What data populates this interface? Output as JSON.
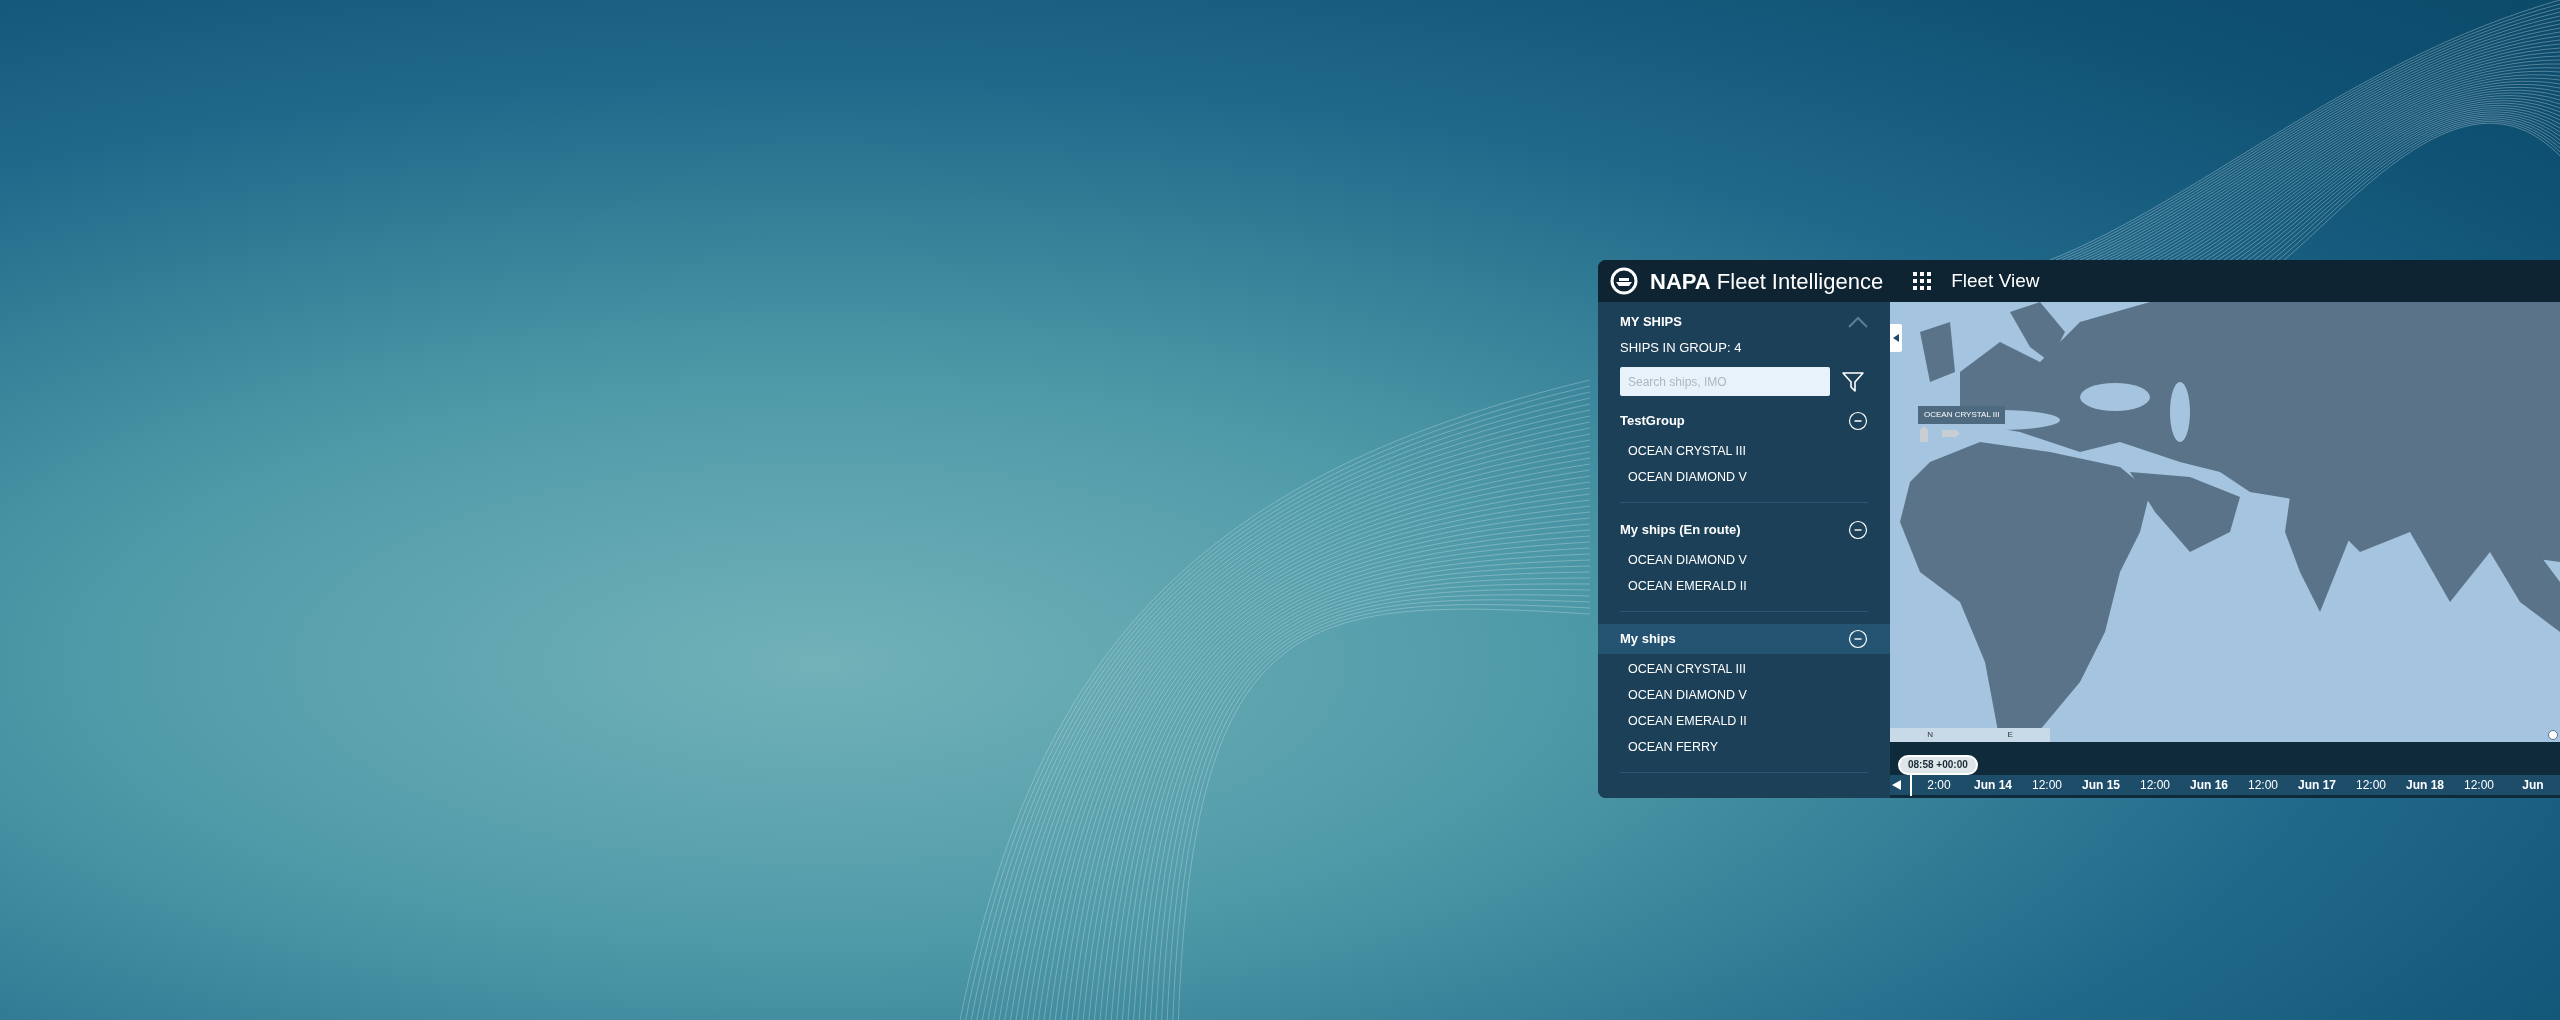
{
  "app": {
    "brand_bold": "NAPA",
    "brand_rest": "Fleet Intelligence",
    "view_title": "Fleet View"
  },
  "sidebar": {
    "title": "MY SHIPS",
    "count": "SHIPS IN GROUP: 4",
    "search": {
      "placeholder": "Search ships, IMO"
    },
    "groups": [
      {
        "name": "TestGroup",
        "expanded": true,
        "selected": false,
        "ships": [
          "OCEAN CRYSTAL III",
          "OCEAN DIAMOND V"
        ]
      },
      {
        "name": "My ships (En route)",
        "expanded": true,
        "selected": false,
        "ships": [
          "OCEAN DIAMOND V",
          "OCEAN EMERALD II"
        ]
      },
      {
        "name": "My ships",
        "expanded": true,
        "selected": true,
        "ships": [
          "OCEAN CRYSTAL III",
          "OCEAN DIAMOND V",
          "OCEAN EMERALD II",
          "OCEAN FERRY"
        ]
      }
    ]
  },
  "map": {
    "kind": "picture",
    "ship_label": "OCEAN CRYSTAL III",
    "legend": [
      "N",
      "E"
    ]
  },
  "timeline": {
    "cursor": "08:58 +00:00",
    "ticks": [
      {
        "label": "2:00",
        "kind": "time"
      },
      {
        "label": "Jun 14",
        "kind": "date"
      },
      {
        "label": "12:00",
        "kind": "time"
      },
      {
        "label": "Jun 15",
        "kind": "date"
      },
      {
        "label": "12:00",
        "kind": "time"
      },
      {
        "label": "Jun 16",
        "kind": "date"
      },
      {
        "label": "12:00",
        "kind": "time"
      },
      {
        "label": "Jun 17",
        "kind": "date"
      },
      {
        "label": "12:00",
        "kind": "time"
      },
      {
        "label": "Jun 18",
        "kind": "date"
      },
      {
        "label": "12:00",
        "kind": "time"
      },
      {
        "label": "Jun",
        "kind": "date"
      }
    ]
  }
}
